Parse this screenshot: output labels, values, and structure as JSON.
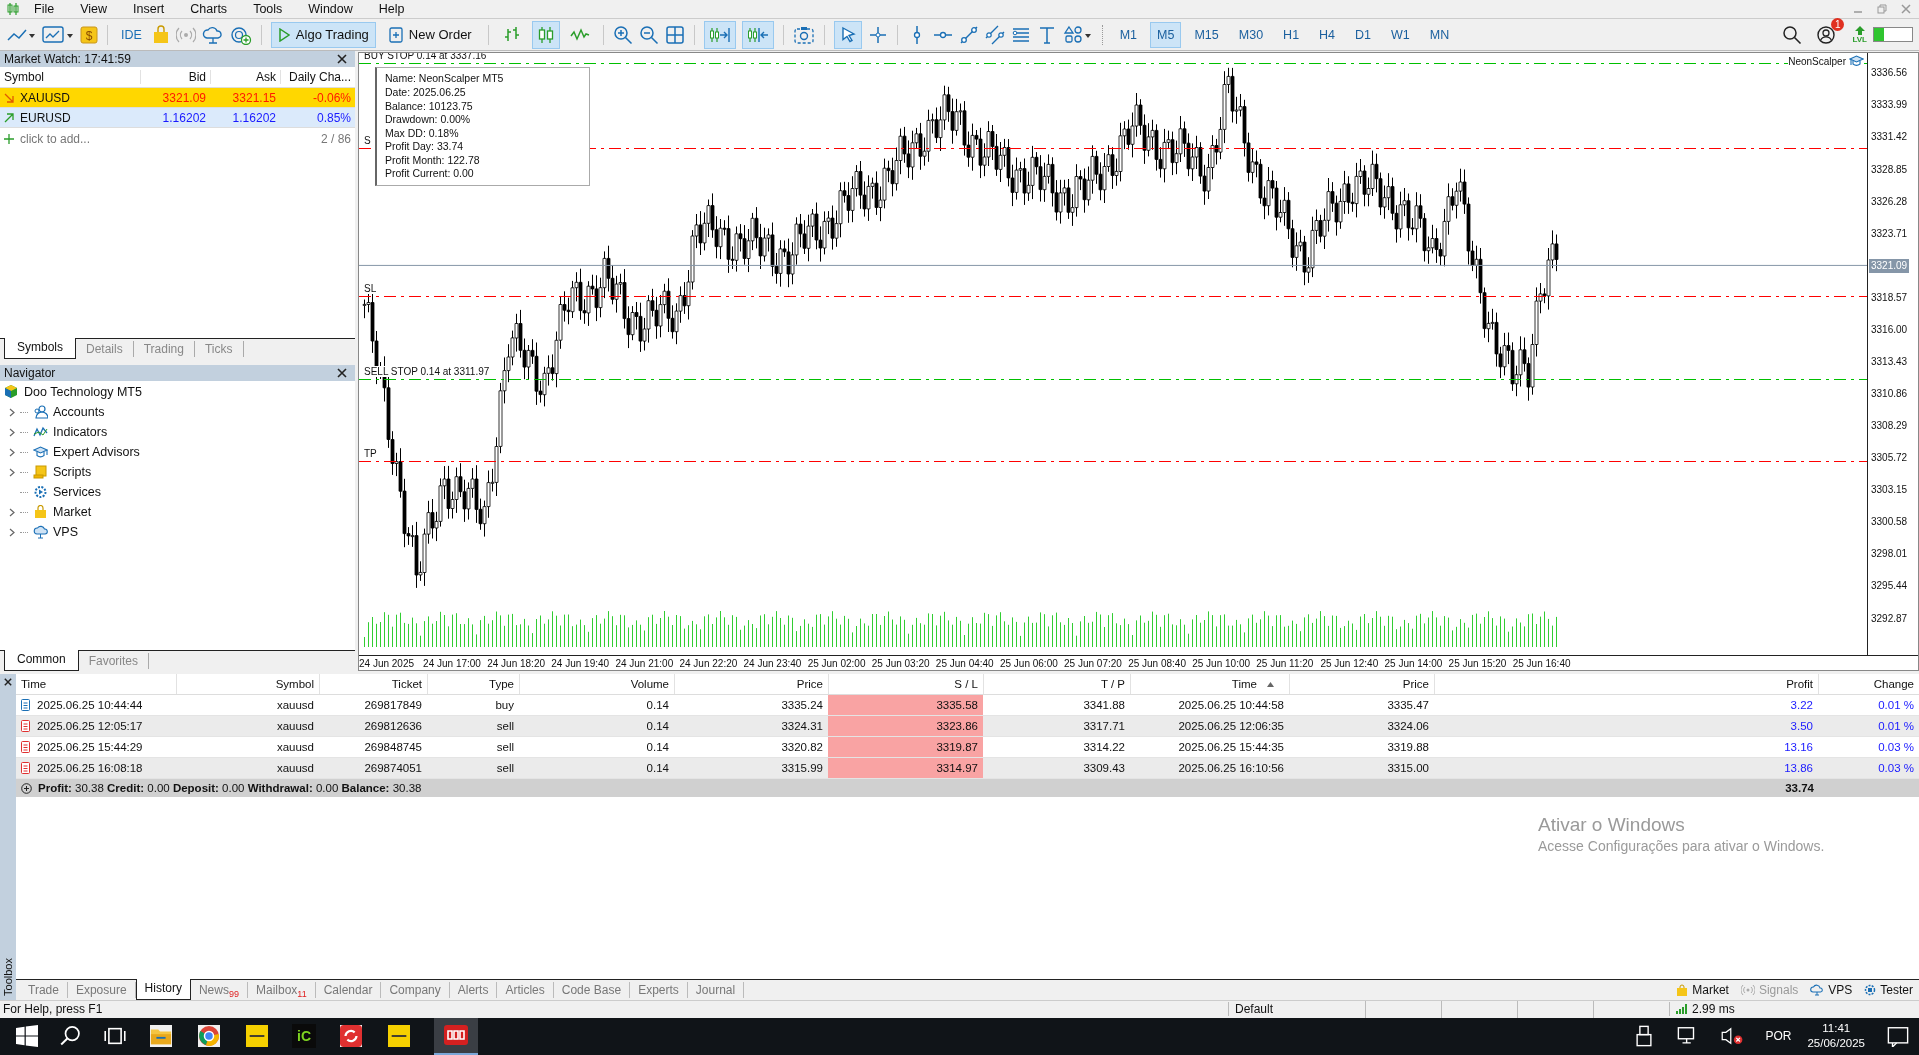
{
  "menu": [
    "File",
    "View",
    "Insert",
    "Charts",
    "Tools",
    "Window",
    "Help"
  ],
  "toolbar": {
    "dollar": "$",
    "ide": "IDE",
    "algo_trading": {
      "label": "Algo Trading",
      "on": true
    },
    "new_order": "New Order",
    "chart_types": [
      {
        "kind": "bars",
        "selected": false
      },
      {
        "kind": "candles",
        "selected": true
      },
      {
        "kind": "line",
        "selected": false
      }
    ],
    "autoscroll": {
      "on": true
    },
    "chart_shift": {
      "on": true
    },
    "cursor": {
      "selected": true
    },
    "timeframes": [
      {
        "label": "M1",
        "selected": false
      },
      {
        "label": "M5",
        "selected": true
      },
      {
        "label": "M15",
        "selected": false
      },
      {
        "label": "M30",
        "selected": false
      },
      {
        "label": "H1",
        "selected": false
      },
      {
        "label": "H4",
        "selected": false
      },
      {
        "label": "D1",
        "selected": false
      },
      {
        "label": "W1",
        "selected": false
      },
      {
        "label": "MN",
        "selected": false
      }
    ],
    "notification_count": "1",
    "level_label": "LVL",
    "level": 0.25
  },
  "market_watch": {
    "title": "Market Watch: 17:41:59",
    "columns": [
      "Symbol",
      "Bid",
      "Ask",
      "Daily Cha..."
    ],
    "rows": [
      {
        "symbol": "XAUUSD",
        "bid": "3321.09",
        "ask": "3321.15",
        "change": "-0.06%",
        "rising": false,
        "selected": true
      },
      {
        "symbol": "EURUSD",
        "bid": "1.16202",
        "ask": "1.16202",
        "change": "0.85%",
        "rising": true,
        "selected": false
      }
    ],
    "add_label": "click to add...",
    "count": "2 / 86",
    "tabs": [
      {
        "label": "Symbols",
        "selected": true
      },
      {
        "label": "Details",
        "selected": false
      },
      {
        "label": "Trading",
        "selected": false
      },
      {
        "label": "Ticks",
        "selected": false
      }
    ]
  },
  "navigator": {
    "title": "Navigator",
    "root": "Doo Technology MT5",
    "items": [
      {
        "label": "Accounts",
        "kind": "accounts",
        "expandable": true
      },
      {
        "label": "Indicators",
        "kind": "indicators",
        "expandable": true
      },
      {
        "label": "Expert Advisors",
        "kind": "experts",
        "expandable": true
      },
      {
        "label": "Scripts",
        "kind": "scripts",
        "expandable": true
      },
      {
        "label": "Services",
        "kind": "services",
        "expandable": false
      },
      {
        "label": "Market",
        "kind": "market",
        "expandable": true
      },
      {
        "label": "VPS",
        "kind": "vps",
        "expandable": true
      }
    ],
    "tabs": [
      {
        "label": "Common",
        "selected": true
      },
      {
        "label": "Favorites",
        "selected": false
      }
    ]
  },
  "chart": {
    "info_box": [
      "Name: NeonScalper MT5",
      "Date: 2025.06.25",
      "Balance: 10123.75",
      "Drawdown: 0.00%",
      "Max DD: 0.18%",
      "Profit Day: 33.74",
      "Profit Month: 122.78",
      "Profit Current: 0.00"
    ],
    "expert": "NeonScalper",
    "lines": [
      {
        "label": "BUY STOP 0.14 at 3337.16",
        "color": "#00c000"
      },
      {
        "label": "S",
        "color": "#ff0000"
      },
      {
        "label": "SL",
        "color": "#ff0000"
      },
      {
        "label": "SELL STOP 0.14 at 3311.97",
        "color": "#00c000"
      },
      {
        "label": "TP",
        "color": "#ff0000"
      }
    ],
    "price_axis": [
      "3336.56",
      "3333.99",
      "3331.42",
      "3328.85",
      "3326.28",
      "3323.71",
      "3321.09",
      "3318.57",
      "3316.00",
      "3313.43",
      "3310.86",
      "3308.29",
      "3305.72",
      "3303.15",
      "3300.58",
      "3298.01",
      "3295.44",
      "3292.87"
    ],
    "time_axis": [
      "24 Jun 2025",
      "24 Jun 17:00",
      "24 Jun 18:20",
      "24 Jun 19:40",
      "24 Jun 21:00",
      "24 Jun 22:20",
      "24 Jun 23:40",
      "25 Jun 02:00",
      "25 Jun 03:20",
      "25 Jun 04:40",
      "25 Jun 06:00",
      "25 Jun 07:20",
      "25 Jun 08:40",
      "25 Jun 10:00",
      "25 Jun 11:20",
      "25 Jun 12:40",
      "25 Jun 14:00",
      "25 Jun 15:20",
      "25 Jun 16:40"
    ]
  },
  "toolbox": {
    "title": "Toolbox",
    "columns": [
      "Time",
      "Symbol",
      "Ticket",
      "Type",
      "Volume",
      "Price",
      "S / L",
      "T / P",
      "Time",
      "Price",
      "Profit",
      "Change"
    ],
    "rows": [
      {
        "buy": true,
        "sl_hit": true,
        "cells": [
          "2025.06.25 10:44:44",
          "xauusd",
          "269817849",
          "buy",
          "0.14",
          "3335.24",
          "3335.58",
          "3341.88",
          "2025.06.25 10:44:58",
          "3335.47",
          "3.22",
          "0.01 %"
        ]
      },
      {
        "buy": false,
        "sl_hit": true,
        "cells": [
          "2025.06.25 12:05:17",
          "xauusd",
          "269812636",
          "sell",
          "0.14",
          "3324.31",
          "3323.86",
          "3317.71",
          "2025.06.25 12:06:35",
          "3324.06",
          "3.50",
          "0.01 %"
        ]
      },
      {
        "buy": false,
        "sl_hit": true,
        "cells": [
          "2025.06.25 15:44:29",
          "xauusd",
          "269848745",
          "sell",
          "0.14",
          "3320.82",
          "3319.87",
          "3314.22",
          "2025.06.25 15:44:35",
          "3319.88",
          "13.16",
          "0.03 %"
        ]
      },
      {
        "buy": false,
        "sl_hit": true,
        "cells": [
          "2025.06.25 16:08:18",
          "xauusd",
          "269874051",
          "sell",
          "0.14",
          "3315.99",
          "3314.97",
          "3309.43",
          "2025.06.25 16:10:56",
          "3315.00",
          "13.86",
          "0.03 %"
        ]
      }
    ],
    "summary": "**Profit:** 30.38 **Credit:** 0.00 **Deposit:** 0.00 **Withdrawal:** 0.00 **Balance:** 30.38",
    "total": "33.74",
    "tabs": [
      {
        "label": "Trade",
        "selected": false
      },
      {
        "label": "Exposure",
        "selected": false
      },
      {
        "label": "History",
        "selected": true
      },
      {
        "label": "News",
        "badge": "99",
        "selected": false
      },
      {
        "label": "Mailbox",
        "badge": "11",
        "selected": false
      },
      {
        "label": "Calendar",
        "selected": false
      },
      {
        "label": "Company",
        "selected": false
      },
      {
        "label": "Alerts",
        "selected": false
      },
      {
        "label": "Articles",
        "selected": false
      },
      {
        "label": "Code Base",
        "selected": false
      },
      {
        "label": "Experts",
        "selected": false
      },
      {
        "label": "Journal",
        "selected": false
      }
    ],
    "services": [
      {
        "label": "Market",
        "kind": "market",
        "disabled": false
      },
      {
        "label": "Signals",
        "kind": "signals",
        "disabled": true
      },
      {
        "label": "VPS",
        "kind": "vps",
        "disabled": false
      },
      {
        "label": "Tester",
        "kind": "tester",
        "disabled": false
      }
    ]
  },
  "activation": {
    "title": "Ativar o Windows",
    "message": "Acesse Configurações para ativar o Windows."
  },
  "status_bar": {
    "help": "For Help, press F1",
    "profile": "Default",
    "ping": "2.99 ms"
  },
  "taskbar": {
    "app_label": "iC",
    "language": "POR",
    "time": "11:41",
    "date": "25/06/2025"
  }
}
